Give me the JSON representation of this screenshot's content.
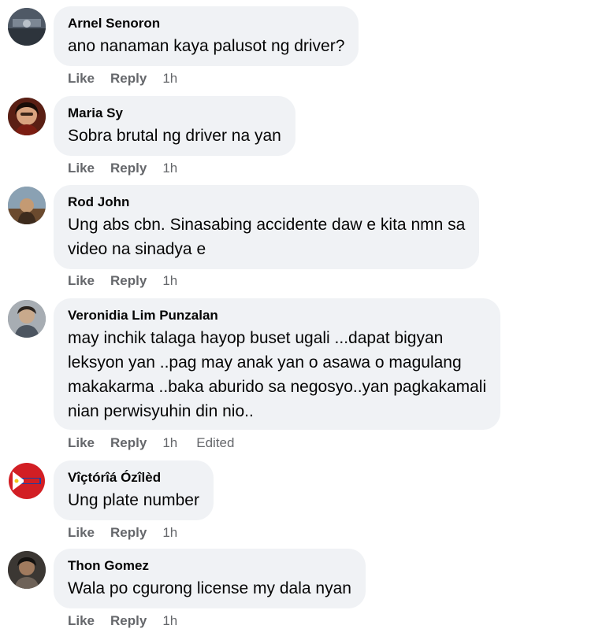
{
  "comments": [
    {
      "name": "Arnel Senoron",
      "text": "ano nanaman kaya palusot ng driver?",
      "like": "Like",
      "reply": "Reply",
      "time": "1h",
      "edited": "",
      "avatar_icon": "profile-photo-icon"
    },
    {
      "name": "Maria Sy",
      "text": "Sobra brutal ng driver na yan",
      "like": "Like",
      "reply": "Reply",
      "time": "1h",
      "edited": "",
      "avatar_icon": "profile-photo-icon"
    },
    {
      "name": "Rod John",
      "text": "Ung abs cbn. Sinasabing accidente daw e kita nmn sa\nvideo na sinadya e",
      "like": "Like",
      "reply": "Reply",
      "time": "1h",
      "edited": "",
      "avatar_icon": "profile-photo-icon"
    },
    {
      "name": "Veronidia Lim Punzalan",
      "text": "may inchik talaga hayop buset ugali ...dapat bigyan\nleksyon yan ..pag may anak yan o asawa o magulang\nmakakarma ..baka aburido sa negosyo..yan pagkakamali\nnian perwisyuhin din nio..",
      "like": "Like",
      "reply": "Reply",
      "time": "1h",
      "edited": "Edited",
      "avatar_icon": "profile-photo-icon"
    },
    {
      "name": "Vîçtórîá Ózîlèd",
      "text": "Ung plate number",
      "like": "Like",
      "reply": "Reply",
      "time": "1h",
      "edited": "",
      "avatar_icon": "flag-logo-icon"
    },
    {
      "name": "Thon Gomez",
      "text": "Wala po cgurong license my dala nyan",
      "like": "Like",
      "reply": "Reply",
      "time": "1h",
      "edited": "",
      "avatar_icon": "profile-photo-icon"
    }
  ],
  "colors": {
    "bubble": "#f0f2f5",
    "name": "#050505",
    "meta": "#65676b"
  }
}
